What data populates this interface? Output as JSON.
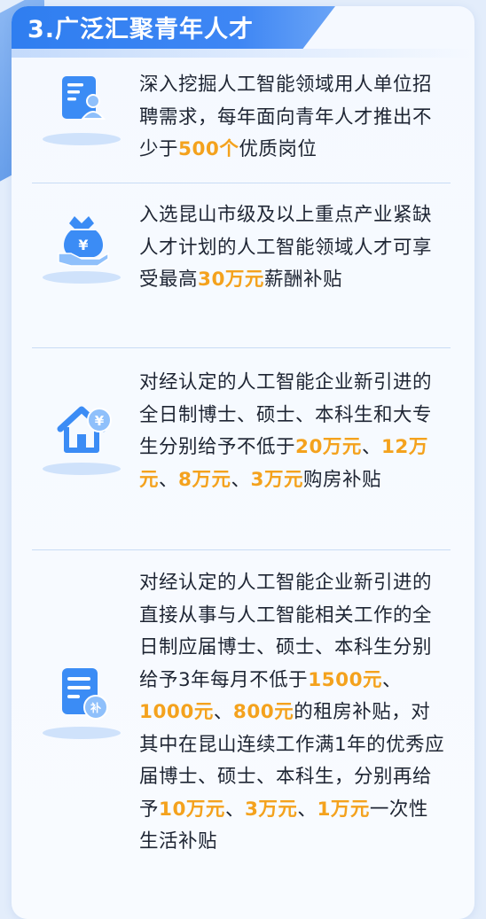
{
  "section_title": "3.广泛汇聚青年人才",
  "colors": {
    "accent": "#2f7ef0",
    "highlight": "#f4a21d",
    "text": "#1e2533",
    "icon": "#3b8cf5"
  },
  "items": [
    {
      "icon": "resume-document-icon",
      "text": {
        "t1": "深入挖掘人工智能领域用人单位招聘需求，每年面向青年人才推出不少于",
        "h1": "500个",
        "t2": "优质岗位"
      }
    },
    {
      "icon": "money-bag-hand-icon",
      "text": {
        "t1": "入选昆山市级及以上重点产业紧缺人才计划的人工智能领域人才可享受最高",
        "h1": "30万元",
        "t2": "薪酬补贴"
      }
    },
    {
      "icon": "house-yen-icon",
      "text": {
        "t1": "对经认定的人工智能企业新引进的全日制博士、硕士、本科生和大专生分别给予不低于",
        "h1": "20万元",
        "s1": "、",
        "h2": "12万元",
        "s2": "、",
        "h3": "8万元",
        "s3": "、",
        "h4": "3万元",
        "t2": "购房补贴"
      }
    },
    {
      "icon": "subsidy-form-icon",
      "text": {
        "t1": "对经认定的人工智能企业新引进的直接从事与人工智能相关工作的全日制应届博士、硕士、本科生分别给予3年每月不低于",
        "h1": "1500元",
        "s1": "、",
        "h2": "1000元",
        "s2": "、",
        "h3": "800元",
        "t2": "的租房补贴，对其中在昆山连续工作满1年的优秀应届博士、硕士、本科生，分别再给予",
        "h4": "10万元",
        "s3": "、",
        "h5": "3万元",
        "s4": "、",
        "h6": "1万元",
        "t3": "一次性生活补贴"
      }
    }
  ]
}
